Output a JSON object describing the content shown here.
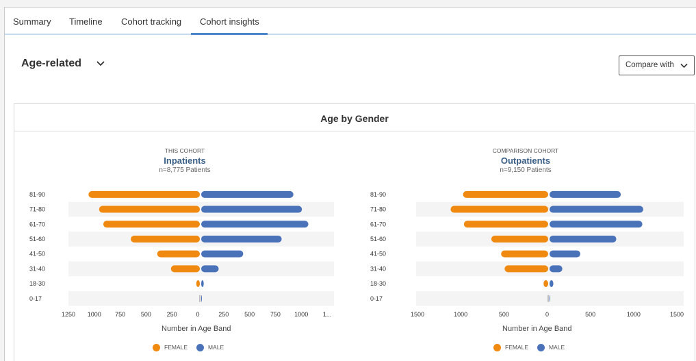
{
  "tabs": [
    {
      "label": "Summary"
    },
    {
      "label": "Timeline"
    },
    {
      "label": "Cohort tracking"
    },
    {
      "label": "Cohort insights"
    }
  ],
  "active_tab": "Cohort insights",
  "filter": {
    "selected": "Age-related",
    "icon": "chevron-down-icon"
  },
  "compare_button": {
    "label": "Compare with",
    "icon": "chevron-down-icon"
  },
  "card": {
    "title": "Age by Gender"
  },
  "colors": {
    "female": "#f0890f",
    "male": "#4a72b8",
    "title_blue": "#3a5f86"
  },
  "panels": [
    {
      "eyebrow": "THIS COHORT",
      "name": "Inpatients",
      "count": "n=8,775 Patients",
      "xlabel": "Number in Age Band"
    },
    {
      "eyebrow": "COMPARISON COHORT",
      "name": "Outpatients",
      "count": "n=9,150 Patients",
      "xlabel": "Number in Age Band"
    }
  ],
  "legend": [
    {
      "label": "FEMALE",
      "color": "#f0890f"
    },
    {
      "label": "MALE",
      "color": "#4a72b8"
    }
  ],
  "chart_data": [
    {
      "type": "bar",
      "title": "Age by Gender",
      "orientation": "horizontal-diverging",
      "categories": [
        "81-90",
        "71-80",
        "61-70",
        "51-60",
        "41-50",
        "31-40",
        "18-30",
        "0-17"
      ],
      "series": [
        {
          "name": "FEMALE",
          "values": [
            1060,
            960,
            920,
            660,
            410,
            280,
            40,
            2
          ]
        },
        {
          "name": "MALE",
          "values": [
            870,
            950,
            1010,
            760,
            400,
            170,
            30,
            4
          ]
        }
      ],
      "xlabel": "Number in Age Band",
      "xticks": [
        "1250",
        "1000",
        "750",
        "500",
        "250",
        "0",
        "250",
        "500",
        "750",
        "1000",
        "1..."
      ],
      "xlim": [
        -1250,
        1250
      ],
      "grid": false,
      "legend": "bottom"
    },
    {
      "type": "bar",
      "title": "Age by Gender",
      "orientation": "horizontal-diverging",
      "categories": [
        "81-90",
        "71-80",
        "61-70",
        "51-60",
        "41-50",
        "31-40",
        "18-30",
        "0-17"
      ],
      "series": [
        {
          "name": "FEMALE",
          "values": [
            970,
            1110,
            960,
            650,
            540,
            500,
            60,
            1
          ]
        },
        {
          "name": "MALE",
          "values": [
            800,
            1050,
            1040,
            750,
            350,
            150,
            50,
            3
          ]
        }
      ],
      "xlabel": "Number in Age Band",
      "xticks": [
        "1500",
        "1000",
        "500",
        "0",
        "500",
        "1000",
        "1500"
      ],
      "xlim": [
        -1500,
        1500
      ],
      "grid": false,
      "legend": "bottom"
    }
  ]
}
